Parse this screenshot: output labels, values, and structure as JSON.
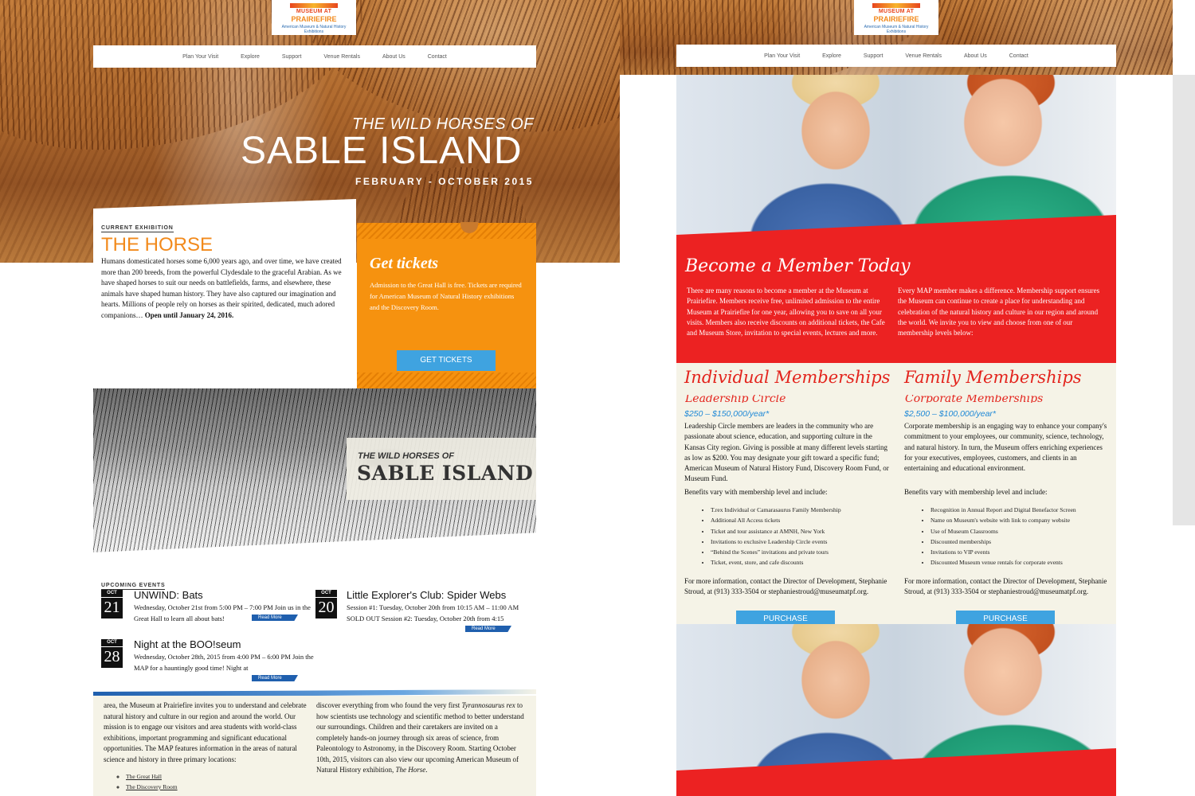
{
  "logo": {
    "line1": "MUSEUM AT",
    "line2": "PRAIRIEFIRE",
    "line3": "American Museum & Natural History Exhibitions"
  },
  "nav": [
    "Plan Your Visit",
    "Explore",
    "Support",
    "Venue Rentals",
    "About Us",
    "Contact"
  ],
  "hero": {
    "subtitle": "THE WILD HORSES OF",
    "title": "SABLE ISLAND",
    "date": "FEBRUARY - OCTOBER 2015"
  },
  "exhibition": {
    "label": "CURRENT EXHIBITION",
    "title": "THE HORSE",
    "body": "Humans domesticated horses some 6,000 years ago, and over time, we have created more than 200 breeds, from the powerful Clydesdale to the graceful Arabian. As we have shaped horses to suit our needs on battlefields, farms, and elsewhere, these animals have shaped human history. They have also captured our imagination and hearts. Millions of people rely on horses as their spirited, dedicated, much adored companions… ",
    "bold": "Open until January 24, 2016."
  },
  "tickets": {
    "title": "Get tickets",
    "body": "Admission to the Great Hall is free. Tickets are required for American Museum of Natural History exhibitions and the Discovery Room.",
    "button": "GET TICKETS"
  },
  "sable": {
    "subtitle": "THE WILD HORSES OF",
    "title": "SABLE ISLAND"
  },
  "events": {
    "label": "UPCOMING EVENTS",
    "items": [
      {
        "month": "OCT",
        "day": "21",
        "title": "UNWIND: Bats",
        "desc": "Wednesday, October 21st from 5:00 PM – 7:00 PM Join us in the Great Hall to learn all about bats!",
        "more": "Read More"
      },
      {
        "month": "OCT",
        "day": "20",
        "title": "Little Explorer's Club: Spider Webs",
        "desc": "Session #1: Tuesday, October 20th from 10:15 AM – 11:00 AM SOLD OUT Session #2: Tuesday, October 20th from 4:15",
        "more": "Read More"
      },
      {
        "month": "OCT",
        "day": "28",
        "title": "Night at the BOO!seum",
        "desc": "Wednesday, October 28th, 2015 from 4:00 PM – 6:00 PM Join the MAP for a hauntingly good time! Night at",
        "more": "Read More"
      }
    ]
  },
  "about": {
    "col1": "area, the Museum at Prairiefire invites you to understand and celebrate natural history and culture in our region and around the world. Our mission is to engage our visitors and area students with world-class exhibitions, important programming and significant educational opportunities. The MAP features information in the areas of natural science and history in three primary locations:",
    "col2a": "discover everything from who found the very first ",
    "col2italic": "Tyrannosaurus rex",
    "col2b": " to how scientists use technology and scientific method to better understand our surroundings. Children and their caretakers are invited on a completely hands-on journey through six areas of science, from Paleontology to Astronomy, in the Discovery Room. Starting October 10th, 2015, visitors can also view our upcoming American Museum of Natural History exhibition, ",
    "col2italic2": "The Horse",
    "col2c": ".",
    "links": [
      "The Great Hall",
      "The Discovery Room"
    ]
  },
  "member": {
    "title": "Become a Member Today",
    "col1": "There are many reasons to become a member at the Museum at Prairiefire. Members receive free, unlimited admission to the entire Museum at Prairiefire for one year, allowing you to save on all your visits. Members also receive discounts on additional tickets, the Cafe and Museum Store, invitation to special events, lectures and more.",
    "col2": "Every MAP member makes a difference. Membership support ensures the Museum can continue to create a place for understanding and celebration of the natural history and culture in our region and around the world. We invite you to view and choose from one of our membership levels below:"
  },
  "individual": {
    "title": "Individual Memberships",
    "ghost": "Leadership Circle",
    "price": "$250 – $150,000/year*",
    "body": "Leadership Circle members are leaders in the community who are passionate about science, education, and supporting culture in the Kansas City region. Giving is possible at many different levels starting as low as $200. You may designate your gift toward a specific fund; American Museum of Natural History Fund, Discovery Room Fund, or Museum Fund.",
    "benefits_intro": "Benefits vary with membership level and include:",
    "benefits": [
      "T.rex Individual or Camarasaurus Family Membership",
      "Additional All Access tickets",
      "Ticket and tour assistance at AMNH, New York",
      "Invitations to exclusive Leadership Circle events",
      "“Behind the Scenes” invitations and private tours",
      "Ticket, event, store, and cafe discounts"
    ],
    "contact": "For more information, contact the Director of Development, Stephanie Stroud, at (913) 333-3504 or stephaniestroud@museumatpf.org.",
    "button": "PURCHASE"
  },
  "family": {
    "title": "Family Memberships",
    "ghost": "Corporate Memberships",
    "price": "$2,500 – $100,000/year*",
    "body": "Corporate membership is an engaging way to enhance your company's commitment to your employees, our community, science, technology, and natural history. In turn, the Museum offers enriching experiences for your executives, employees, customers, and clients in an entertaining and educational environment.",
    "benefits_intro": "Benefits vary with membership level and include:",
    "benefits": [
      "Recognition in Annual Report and Digital Benefactor Screen",
      "Name on Museum's website with link to company website",
      "Use of Museum Classrooms",
      "Discounted memberships",
      "Invitations to VIP events",
      "Discounted Museum venue rentals for corporate events"
    ],
    "contact": "For more information, contact the Director of Development, Stephanie Stroud, at (913) 333-3504 or stephaniestroud@museumatpf.org.",
    "button": "PURCHASE"
  }
}
